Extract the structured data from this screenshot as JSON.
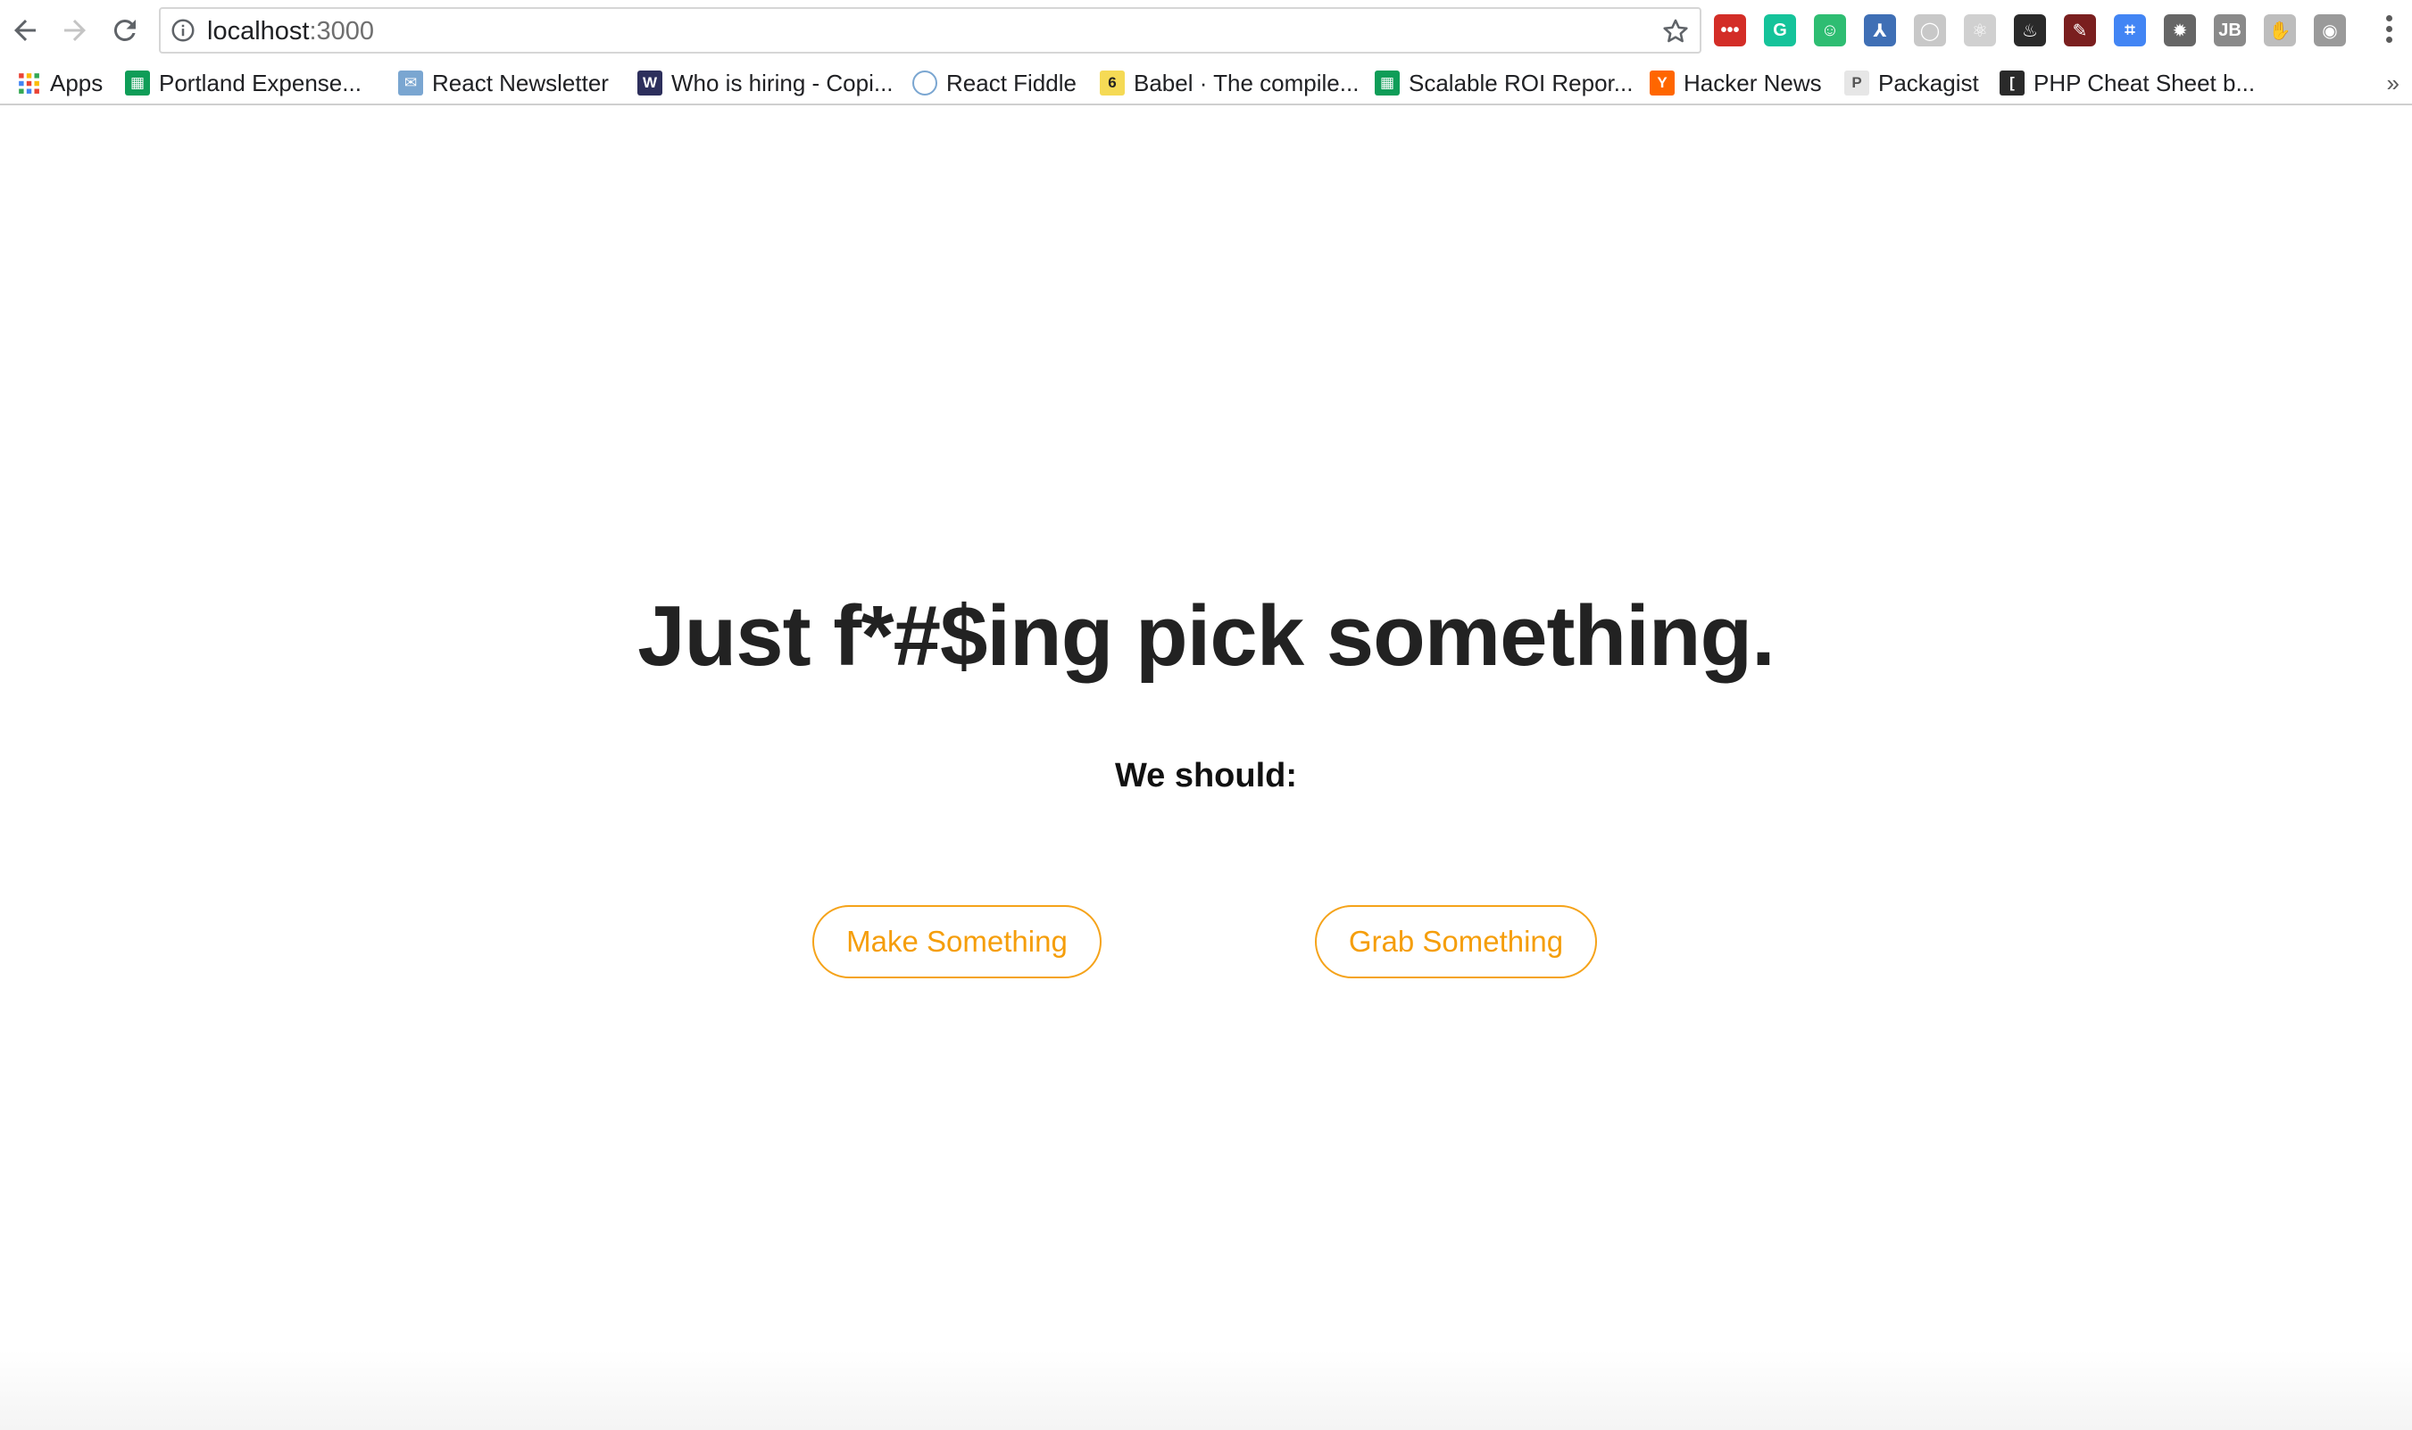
{
  "browser": {
    "url_host": "localhost",
    "url_port": ":3000"
  },
  "bookmarks": [
    {
      "label": "Apps",
      "icon": "apps-grid-icon"
    },
    {
      "label": "Portland Expense...",
      "icon": "sheets-icon"
    },
    {
      "label": "React Newsletter",
      "icon": "react-newsletter-icon"
    },
    {
      "label": "Who is hiring - Copi...",
      "icon": "whoishiring-icon"
    },
    {
      "label": "React Fiddle",
      "icon": "cloud-icon"
    },
    {
      "label": "Babel · The compile...",
      "icon": "babel-icon"
    },
    {
      "label": "Scalable ROI Repor...",
      "icon": "sheets-icon"
    },
    {
      "label": "Hacker News",
      "icon": "hacker-news-icon"
    },
    {
      "label": "Packagist",
      "icon": "packagist-icon"
    },
    {
      "label": "PHP Cheat Sheet b...",
      "icon": "php-icon"
    }
  ],
  "bookmarks_overflow": "»",
  "extensions": [
    {
      "name": "lastpass-icon",
      "glyph": "•••",
      "color": "#d32d27"
    },
    {
      "name": "grammarly-icon",
      "glyph": "G",
      "color": "#15c39a"
    },
    {
      "name": "extension-green-icon",
      "glyph": "☺",
      "color": "#2ebd72"
    },
    {
      "name": "extension-dev-icon",
      "glyph": "⅄",
      "color": "#3f6fb5"
    },
    {
      "name": "extension-circle-icon",
      "glyph": "◯",
      "color": "#c8c8c8"
    },
    {
      "name": "react-devtools-icon",
      "glyph": "⚛",
      "color": "#d0d0d0"
    },
    {
      "name": "extension-flame-icon",
      "glyph": "♨",
      "color": "#2a2a2a"
    },
    {
      "name": "extension-picker-icon",
      "glyph": "✎",
      "color": "#7a1f1f"
    },
    {
      "name": "extension-blue-icon",
      "glyph": "⌗",
      "color": "#4285f4"
    },
    {
      "name": "extension-gear-icon",
      "glyph": "✹",
      "color": "#666666"
    },
    {
      "name": "jetbrains-icon",
      "glyph": "JB",
      "color": "#8a8a8a"
    },
    {
      "name": "extension-hand-icon",
      "glyph": "✋",
      "color": "#bdbdbd"
    },
    {
      "name": "camera-icon",
      "glyph": "◉",
      "color": "#9a9a9a"
    }
  ],
  "main": {
    "headline": "Just f*#$ing pick something.",
    "subhead": "We should:",
    "buttons": {
      "make": "Make Something",
      "grab": "Grab Something"
    }
  },
  "colors": {
    "accent": "#f59e0b",
    "headline": "#222222"
  }
}
